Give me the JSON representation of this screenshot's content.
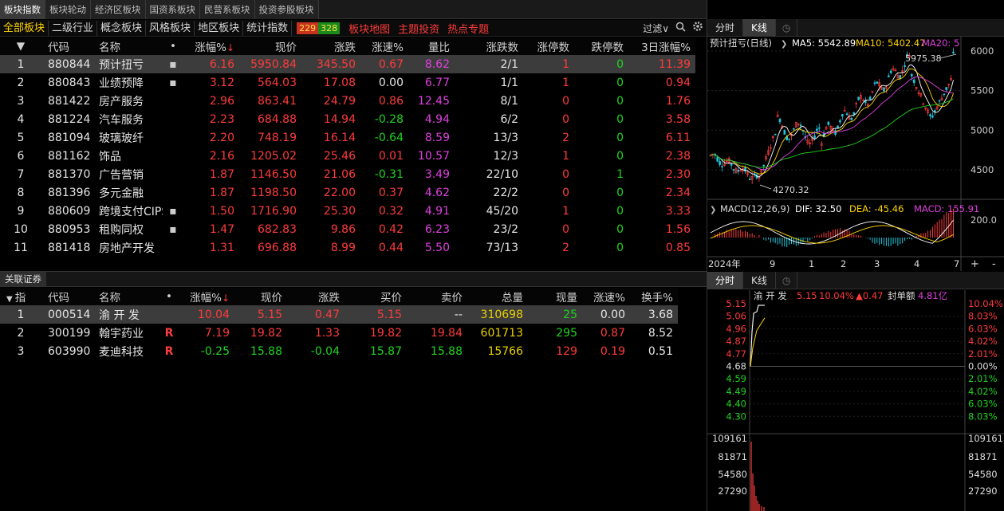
{
  "top_tabs": [
    "板块指数",
    "板块轮动",
    "经济区板块",
    "国资系板块",
    "民营系板块",
    "投资参股板块"
  ],
  "sub_nav": {
    "items": [
      "全部板块",
      "二级行业",
      "概念板块",
      "风格板块",
      "地区板块",
      "统计指数"
    ],
    "up_count": "229",
    "down_count": "328",
    "links": [
      "板块地图",
      "主题投资",
      "热点专题"
    ],
    "filter_label": "过滤",
    "filter_caret": "∨"
  },
  "sector_table": {
    "headers": [
      "代码",
      "名称",
      "•",
      "涨幅%",
      "现价",
      "涨跌",
      "涨速%",
      "量比",
      "涨跌数",
      "涨停数",
      "跌停数",
      "3日涨幅%"
    ],
    "sort_indicator": "↓",
    "rows": [
      {
        "idx": "1",
        "code": "880844",
        "name": "预计扭亏",
        "mark": "▪",
        "chg": "6.16",
        "price": "5950.84",
        "diff": "345.50",
        "speed": "0.67",
        "speed_color": "red",
        "vr": "8.62",
        "ud": "2/1",
        "lu": "1",
        "lu_color": "red",
        "ld": "0",
        "ld_color": "green",
        "chg3": "11.39"
      },
      {
        "idx": "2",
        "code": "880843",
        "name": "业绩预降",
        "mark": "▪",
        "chg": "3.12",
        "price": "564.03",
        "diff": "17.08",
        "speed": "0.00",
        "speed_color": "white",
        "vr": "6.77",
        "ud": "1/1",
        "lu": "1",
        "lu_color": "red",
        "ld": "0",
        "ld_color": "green",
        "chg3": "0.94"
      },
      {
        "idx": "3",
        "code": "881422",
        "name": "房产服务",
        "mark": "",
        "chg": "2.96",
        "price": "863.41",
        "diff": "24.79",
        "speed": "0.86",
        "speed_color": "red",
        "vr": "12.45",
        "ud": "8/1",
        "lu": "0",
        "lu_color": "red",
        "ld": "0",
        "ld_color": "green",
        "chg3": "1.76"
      },
      {
        "idx": "4",
        "code": "881224",
        "name": "汽车服务",
        "mark": "",
        "chg": "2.23",
        "price": "684.88",
        "diff": "14.94",
        "speed": "-0.28",
        "speed_color": "green",
        "vr": "4.94",
        "ud": "6/2",
        "lu": "0",
        "lu_color": "red",
        "ld": "0",
        "ld_color": "green",
        "chg3": "3.58"
      },
      {
        "idx": "5",
        "code": "881094",
        "name": "玻璃玻纤",
        "mark": "",
        "chg": "2.20",
        "price": "748.19",
        "diff": "16.14",
        "speed": "-0.64",
        "speed_color": "green",
        "vr": "8.59",
        "ud": "13/3",
        "lu": "2",
        "lu_color": "red",
        "ld": "0",
        "ld_color": "green",
        "chg3": "6.11"
      },
      {
        "idx": "6",
        "code": "881162",
        "name": "饰品",
        "mark": "",
        "chg": "2.16",
        "price": "1205.02",
        "diff": "25.46",
        "speed": "0.01",
        "speed_color": "red",
        "vr": "10.57",
        "ud": "12/3",
        "lu": "1",
        "lu_color": "red",
        "ld": "0",
        "ld_color": "green",
        "chg3": "2.38"
      },
      {
        "idx": "7",
        "code": "881370",
        "name": "广告营销",
        "mark": "",
        "chg": "1.87",
        "price": "1146.50",
        "diff": "21.06",
        "speed": "-0.31",
        "speed_color": "green",
        "vr": "3.49",
        "ud": "22/10",
        "lu": "0",
        "lu_color": "red",
        "ld": "1",
        "ld_color": "green",
        "chg3": "2.30"
      },
      {
        "idx": "8",
        "code": "881396",
        "name": "多元金融",
        "mark": "",
        "chg": "1.87",
        "price": "1198.50",
        "diff": "22.00",
        "speed": "0.37",
        "speed_color": "red",
        "vr": "4.62",
        "ud": "22/2",
        "lu": "0",
        "lu_color": "red",
        "ld": "0",
        "ld_color": "green",
        "chg3": "2.34"
      },
      {
        "idx": "9",
        "code": "880609",
        "name": "跨境支付CIPS",
        "mark": "▪",
        "chg": "1.50",
        "price": "1716.90",
        "diff": "25.30",
        "speed": "0.32",
        "speed_color": "red",
        "vr": "4.91",
        "ud": "45/20",
        "lu": "1",
        "lu_color": "red",
        "ld": "0",
        "ld_color": "green",
        "chg3": "3.33"
      },
      {
        "idx": "10",
        "code": "880953",
        "name": "租购同权",
        "mark": "▪",
        "chg": "1.47",
        "price": "682.83",
        "diff": "9.86",
        "speed": "0.42",
        "speed_color": "red",
        "vr": "6.23",
        "ud": "23/2",
        "lu": "0",
        "lu_color": "red",
        "ld": "0",
        "ld_color": "green",
        "chg3": "1.56"
      },
      {
        "idx": "11",
        "code": "881418",
        "name": "房地产开发",
        "mark": "",
        "chg": "1.31",
        "price": "696.88",
        "diff": "8.99",
        "speed": "0.44",
        "speed_color": "red",
        "vr": "5.50",
        "ud": "73/13",
        "lu": "2",
        "lu_color": "red",
        "ld": "0",
        "ld_color": "green",
        "chg3": "0.85"
      }
    ]
  },
  "related": {
    "tab_label": "关联证券",
    "headers": [
      "指",
      "代码",
      "名称",
      "•",
      "涨幅%",
      "现价",
      "涨跌",
      "买价",
      "卖价",
      "总量",
      "现量",
      "涨速%",
      "换手%"
    ],
    "sort_indicator": "↓",
    "header_caret": "▼",
    "rows": [
      {
        "idx": "1",
        "code": "000514",
        "name": "渝 开 发",
        "badge": "",
        "chg": "10.04",
        "chg_color": "red",
        "price": "5.15",
        "diff": "0.47",
        "bid": "5.15",
        "ask": "--",
        "vol": "310698",
        "cur": "25",
        "cur_color": "green",
        "speed": "0.00",
        "speed_color": "white",
        "turn": "3.68"
      },
      {
        "idx": "2",
        "code": "300199",
        "name": "翰宇药业",
        "badge": "R",
        "chg": "7.19",
        "chg_color": "red",
        "price": "19.82",
        "diff": "1.33",
        "bid": "19.82",
        "ask": "19.84",
        "vol": "601713",
        "cur": "295",
        "cur_color": "green",
        "speed": "0.87",
        "speed_color": "red",
        "turn": "8.52"
      },
      {
        "idx": "3",
        "code": "603990",
        "name": "麦迪科技",
        "badge": "R",
        "chg": "-0.25",
        "chg_color": "green",
        "price": "15.88",
        "diff": "-0.04",
        "bid": "15.87",
        "ask": "15.88",
        "vol": "15766",
        "cur": "129",
        "cur_color": "red",
        "speed": "0.19",
        "speed_color": "red",
        "turn": "0.51"
      }
    ]
  },
  "kline": {
    "tabs": [
      "分时",
      "K线"
    ],
    "title": "预计扭亏(日线)",
    "ma_labels": [
      {
        "text": "MA5: 5542.89",
        "color": "#ffffff"
      },
      {
        "text": "MA10: 5402.47",
        "color": "#ffd400"
      },
      {
        "text": "MA20: 5",
        "color": "#e040e0"
      }
    ],
    "y_ticks": [
      "6000",
      "5500",
      "5000",
      "4500"
    ],
    "high_label": "5975.38",
    "low_label": "4270.32",
    "macd_title": "MACD(12,26,9)",
    "macd_labels": [
      {
        "text": "DIF: 32.50",
        "color": "#ffffff"
      },
      {
        "text": "DEA: -45.46",
        "color": "#ffd400"
      },
      {
        "text": "MACD: 155.91",
        "color": "#e040e0"
      }
    ],
    "macd_y_tick": "200.0",
    "x_labels": [
      "2024年",
      "9",
      "1",
      "2",
      "3",
      "4",
      "7"
    ],
    "zoom_in": "+",
    "zoom_out": "-",
    "colors": {
      "up": "#ff3b3b",
      "down": "#1fc8e0",
      "ma5": "#ffffff",
      "ma10": "#ffd400",
      "ma20": "#e040e0",
      "ma60": "#1fd41f"
    }
  },
  "intraday": {
    "tabs": [
      "分时",
      "K线"
    ],
    "name": "渝 开 发",
    "price": "5.15",
    "pct": "10.04%",
    "diff": "▲0.47",
    "seal_label": "封单额",
    "seal_value": "4.81亿",
    "price_ticks": [
      "5.15",
      "5.06",
      "4.96",
      "4.87",
      "4.77",
      "4.68",
      "4.59",
      "4.49",
      "4.40",
      "4.30"
    ],
    "pct_ticks": [
      "10.04%",
      "8.03%",
      "6.03%",
      "4.02%",
      "2.01%",
      "0.00%",
      "2.01%",
      "4.02%",
      "6.03%",
      "8.03%"
    ],
    "vol_ticks": [
      "109161",
      "81871",
      "54580",
      "27290"
    ]
  }
}
